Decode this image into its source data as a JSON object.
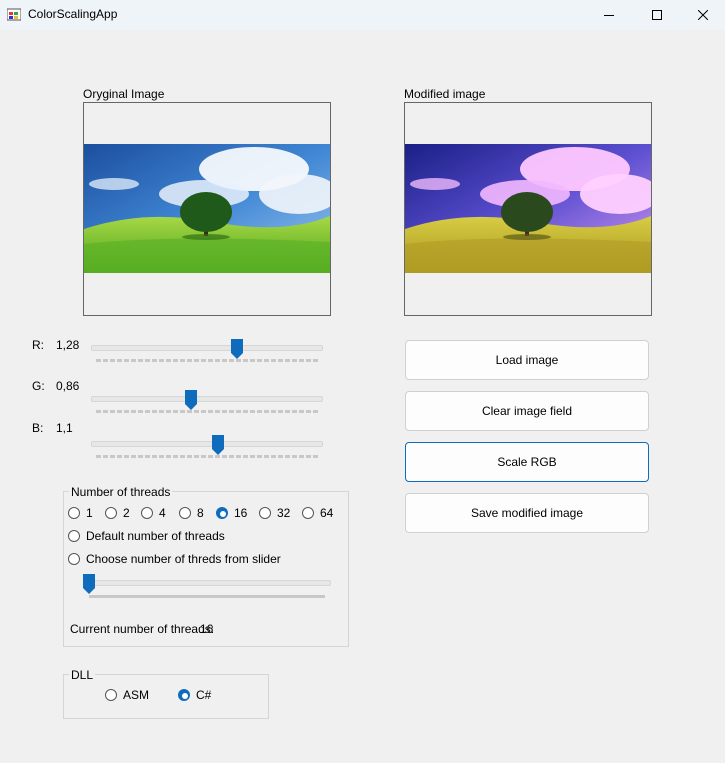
{
  "window": {
    "title": "ColorScalingApp",
    "icon": "app-icon"
  },
  "images": {
    "original_label": "Oryginal Image",
    "modified_label": "Modified image"
  },
  "rgb": {
    "r_label": "R:",
    "r_value": "1,28",
    "g_label": "G:",
    "g_value": "0,86",
    "b_label": "B:",
    "b_value": "1,1"
  },
  "buttons": {
    "load": "Load image",
    "clear": "Clear image field",
    "scale": "Scale RGB",
    "save": "Save modified image"
  },
  "threads": {
    "group_title": "Number of threads",
    "options": [
      "1",
      "2",
      "4",
      "8",
      "16",
      "32",
      "64"
    ],
    "selected": "16",
    "default_label": "Default number of threads",
    "slider_label": "Choose number of threds from slider",
    "current_label": "Current number of threads:",
    "current_value": "16"
  },
  "dll": {
    "group_title": "DLL",
    "options": [
      "ASM",
      "C#"
    ],
    "selected": "C#"
  },
  "colors": {
    "accent": "#0f6cbd"
  }
}
